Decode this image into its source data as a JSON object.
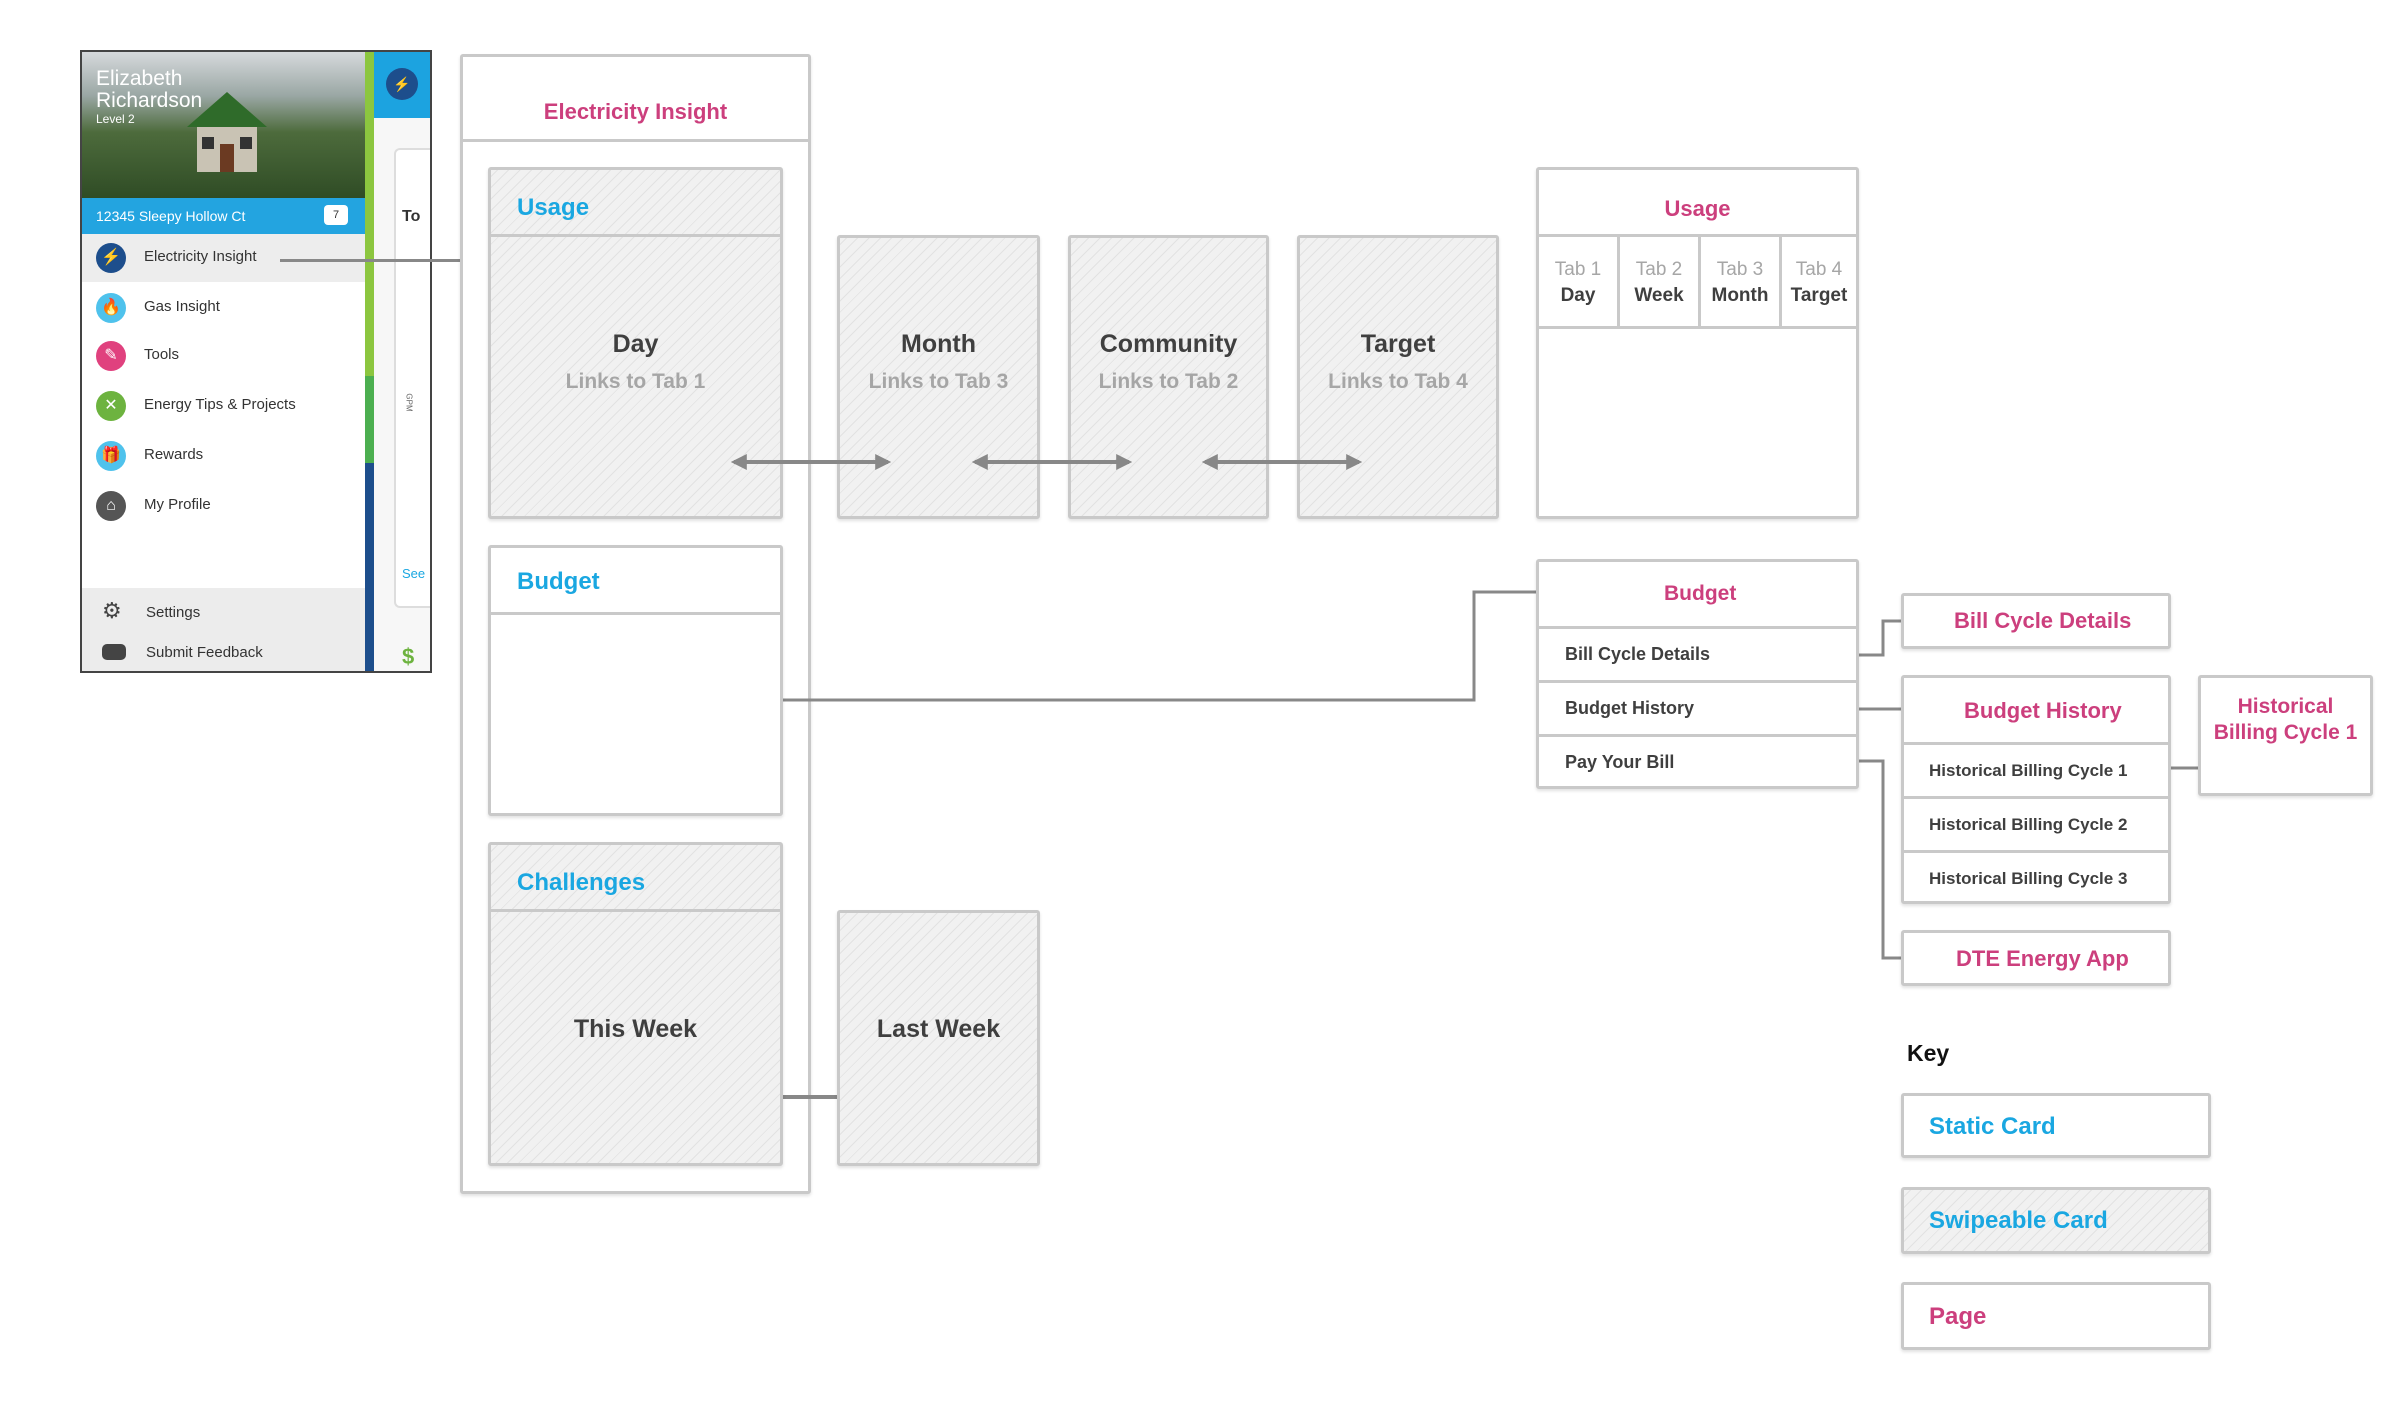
{
  "colors": {
    "static_title": "#1aa7e1",
    "page_title": "#cc3f7d",
    "connector": "#888888",
    "dot": "#1aa7e1"
  },
  "phone": {
    "user_name_line1": "Elizabeth",
    "user_name_line2": "Richardson",
    "level": "Level 2",
    "address": "12345 Sleepy Hollow Ct",
    "notification_count": "7",
    "menu": [
      {
        "label": "Electricity Insight",
        "icon": "lightning-icon"
      },
      {
        "label": "Gas Insight",
        "icon": "flame-icon"
      },
      {
        "label": "Tools",
        "icon": "plug-icon"
      },
      {
        "label": "Energy Tips & Projects",
        "icon": "tools-icon"
      },
      {
        "label": "Rewards",
        "icon": "gift-icon"
      },
      {
        "label": "My Profile",
        "icon": "home-icon"
      }
    ],
    "footer": [
      {
        "label": "Settings",
        "icon": "gear-icon"
      },
      {
        "label": "Submit Feedback",
        "icon": "speech-bubble-icon"
      }
    ],
    "peek": {
      "header_partial": "To",
      "gauge_label": "GPM",
      "link_partial": "See",
      "dollar": "$"
    }
  },
  "electricity_insight": {
    "title": "Electricity Insight",
    "usage": {
      "title": "Usage",
      "cards": [
        {
          "title": "Day",
          "subtitle": "Links to Tab 1"
        },
        {
          "title": "Month",
          "subtitle": "Links to Tab 3"
        },
        {
          "title": "Community",
          "subtitle": "Links to Tab 2"
        },
        {
          "title": "Target",
          "subtitle": "Links to Tab 4"
        }
      ]
    },
    "budget": {
      "title": "Budget"
    },
    "challenges": {
      "title": "Challenges",
      "cards": [
        {
          "title": "This Week"
        },
        {
          "title": "Last Week"
        }
      ]
    }
  },
  "usage_page": {
    "title": "Usage",
    "tabs": [
      {
        "num": "Tab 1",
        "label": "Day"
      },
      {
        "num": "Tab 2",
        "label": "Week"
      },
      {
        "num": "Tab 3",
        "label": "Month"
      },
      {
        "num": "Tab 4",
        "label": "Target"
      }
    ]
  },
  "budget_page": {
    "title": "Budget",
    "rows": [
      "Bill Cycle Details",
      "Budget History",
      "Pay Your Bill"
    ]
  },
  "bill_cycle_page": {
    "title": "Bill Cycle Details"
  },
  "budget_history_page": {
    "title": "Budget History",
    "rows": [
      "Historical Billing Cycle 1",
      "Historical Billing Cycle 2",
      "Historical Billing Cycle 3"
    ]
  },
  "historical_cycle_page": {
    "title_line1": "Historical",
    "title_line2": "Billing Cycle 1"
  },
  "dte_app_page": {
    "title": "DTE Energy App"
  },
  "key": {
    "title": "Key",
    "items": [
      {
        "label": "Static Card",
        "type": "static"
      },
      {
        "label": "Swipeable Card",
        "type": "swipeable"
      },
      {
        "label": "Page",
        "type": "page"
      }
    ]
  }
}
